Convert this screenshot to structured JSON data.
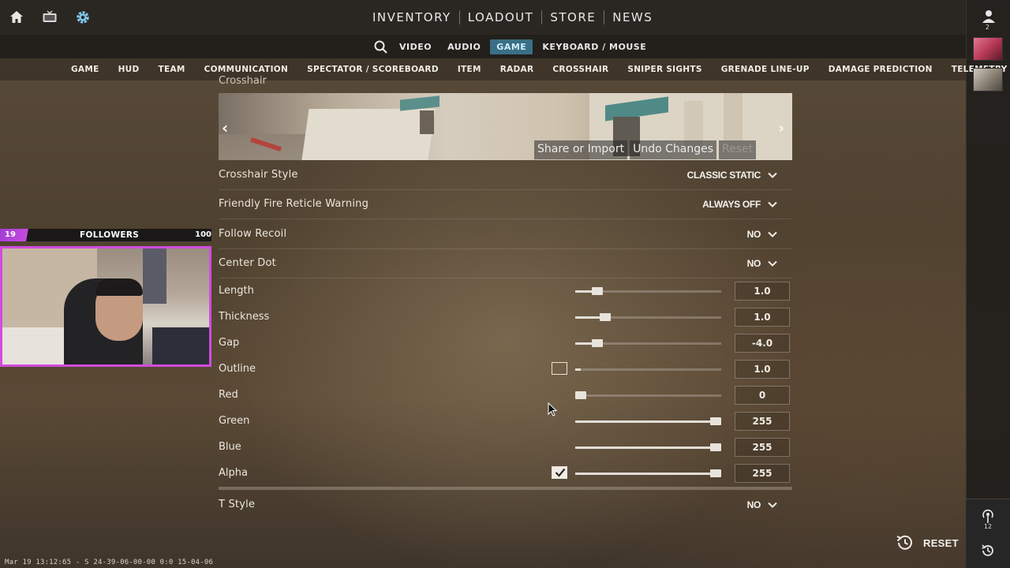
{
  "nav": {
    "main_tabs": [
      "INVENTORY",
      "LOADOUT",
      "STORE",
      "NEWS"
    ],
    "icons": [
      "home-icon",
      "tv-icon",
      "gear-icon"
    ]
  },
  "subnav": {
    "tabs": [
      "VIDEO",
      "AUDIO",
      "GAME",
      "KEYBOARD / MOUSE"
    ],
    "active": "GAME"
  },
  "categories": [
    "GAME",
    "HUD",
    "TEAM",
    "COMMUNICATION",
    "SPECTATOR / SCOREBOARD",
    "ITEM",
    "RADAR",
    "CROSSHAIR",
    "SNIPER SIGHTS",
    "GRENADE LINE-UP",
    "DAMAGE PREDICTION",
    "TELEMETRY"
  ],
  "preview": {
    "section_title": "Crosshair",
    "share_label": "Share or Import",
    "undo_label": "Undo Changes",
    "reset_label": "Reset"
  },
  "dropdowns": [
    {
      "label": "Crosshair Style",
      "value": "CLASSIC STATIC"
    },
    {
      "label": "Friendly Fire Reticle Warning",
      "value": "ALWAYS OFF"
    },
    {
      "label": "Follow Recoil",
      "value": "NO"
    },
    {
      "label": "Center Dot",
      "value": "NO"
    }
  ],
  "sliders": [
    {
      "label": "Length",
      "value": "1.0",
      "fraction": 0.12,
      "checkbox": null
    },
    {
      "label": "Thickness",
      "value": "1.0",
      "fraction": 0.18,
      "checkbox": null
    },
    {
      "label": "Gap",
      "value": "-4.0",
      "fraction": 0.12,
      "checkbox": null
    },
    {
      "label": "Outline",
      "value": "1.0",
      "fraction": 0.0,
      "checkbox": false
    },
    {
      "label": "Red",
      "value": "0",
      "fraction": 0.0,
      "checkbox": null
    },
    {
      "label": "Green",
      "value": "255",
      "fraction": 1.0,
      "checkbox": null
    },
    {
      "label": "Blue",
      "value": "255",
      "fraction": 1.0,
      "checkbox": null
    },
    {
      "label": "Alpha",
      "value": "255",
      "fraction": 1.0,
      "checkbox": true
    }
  ],
  "t_style": {
    "label": "T Style",
    "value": "NO"
  },
  "overlay": {
    "followers_count": "19",
    "followers_label": "FOLLOWERS",
    "followers_goal": "100"
  },
  "right_rail": {
    "friends_count": "2",
    "antenna_count": "12"
  },
  "footer": {
    "reset_label": "RESET",
    "status_line": "Mar 19 13:12:65 - S 24-39-06-00-00 0:0 15-04-06"
  },
  "colors": {
    "accent_active_tab": "#3a6f86",
    "webcam_border": "#d24be0"
  }
}
